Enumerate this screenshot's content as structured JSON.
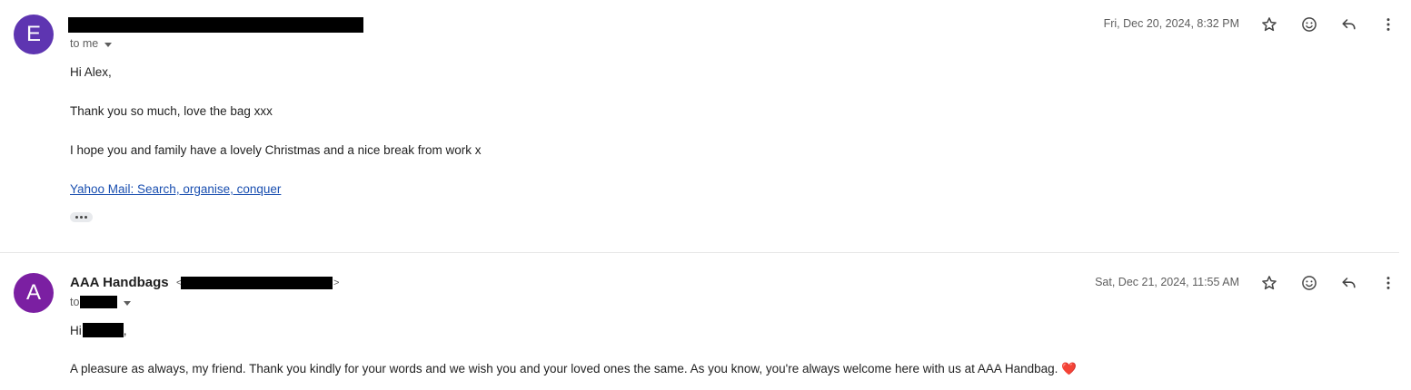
{
  "colors": {
    "avatar_e": "#5e35b1",
    "avatar_a": "#7b1fa2",
    "link": "#1a4fb0"
  },
  "message1": {
    "avatar_letter": "E",
    "to_label": "to me",
    "date": "Fri, Dec 20, 2024, 8:32 PM",
    "greeting": "Hi Alex,",
    "line1": "Thank you so much, love the bag xxx",
    "line2": "I hope you and family have a lovely Christmas and a nice break from work x",
    "signature_link": "Yahoo Mail: Search, organise, conquer",
    "icons": [
      "star-icon",
      "emoji-icon",
      "reply-icon",
      "more-vert-icon"
    ]
  },
  "message2": {
    "avatar_letter": "A",
    "sender_name": "AAA Handbags",
    "angle_open": "<",
    "angle_close": ">",
    "to_label": "to",
    "date": "Sat, Dec 21, 2024, 11:55 AM",
    "greeting_prefix": "Hi",
    "greeting_suffix": ",",
    "body": "A pleasure as always, my friend. Thank you kindly for your words and we wish you and your loved ones the same. As you know, you're always welcome here with us at AAA Handbag.",
    "heart": "❤️",
    "icons": [
      "star-icon",
      "emoji-icon",
      "reply-icon",
      "more-vert-icon"
    ]
  }
}
